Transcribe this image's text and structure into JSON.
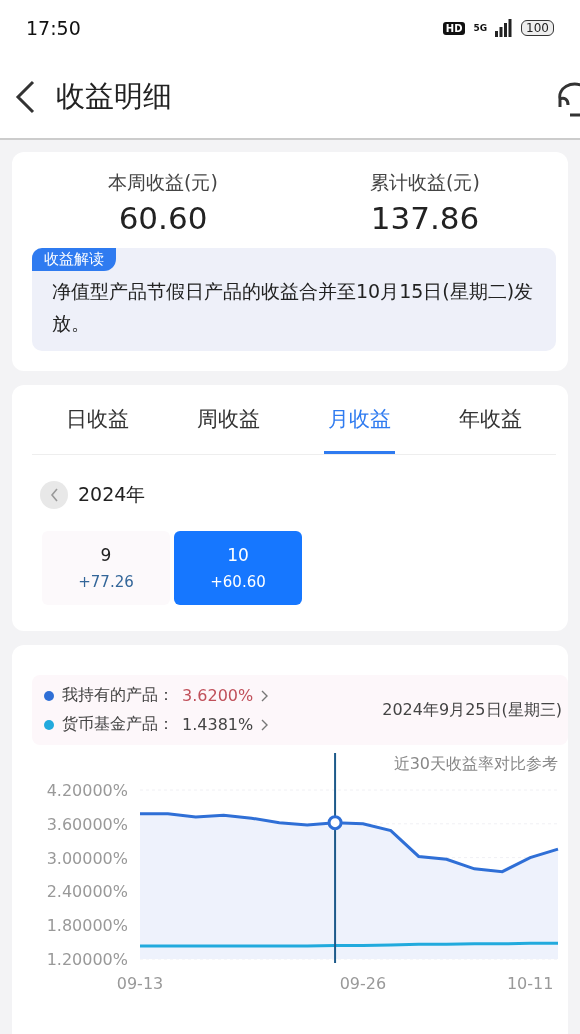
{
  "status_bar": {
    "time": "17:50",
    "hd": "HD",
    "network": "5G",
    "battery": "100"
  },
  "header": {
    "title": "收益明细"
  },
  "summary": {
    "stats": [
      {
        "label": "本周收益(元)",
        "value": "60.60"
      },
      {
        "label": "累计收益(元)",
        "value": "137.86"
      }
    ],
    "note": {
      "tag": "收益解读",
      "text": "净值型产品节假日产品的收益合并至10月15日(星期二)发放。"
    }
  },
  "tabs": [
    {
      "label": "日收益",
      "selected": false
    },
    {
      "label": "周收益",
      "selected": false
    },
    {
      "label": "月收益",
      "selected": true
    },
    {
      "label": "年收益",
      "selected": false
    }
  ],
  "year": "2024年",
  "months": [
    {
      "month": "9",
      "amount": "+77.26",
      "selected": false
    },
    {
      "month": "10",
      "amount": "+60.60",
      "selected": true
    }
  ],
  "comparison": {
    "legend": [
      {
        "label": "我持有的产品：",
        "value": "3.6200%",
        "color": "#2f6fd6"
      },
      {
        "label": "货币基金产品：",
        "value": "1.4381%",
        "color": "#22aadd"
      }
    ],
    "date": "2024年9月25日(星期三)",
    "caption": "近30天收益率对比参考",
    "chart_data": {
      "type": "line",
      "categories": [
        "09-13",
        null,
        null,
        null,
        null,
        null,
        null,
        null,
        "09-26",
        null,
        null,
        null,
        null,
        null,
        "10-11",
        null
      ],
      "series": [
        {
          "color": "#2f6fd6",
          "values": [
            3.78,
            3.78,
            3.72,
            3.75,
            3.7,
            3.62,
            3.58,
            3.62,
            3.6,
            3.48,
            3.02,
            2.97,
            2.8,
            2.75,
            3.0,
            3.15
          ]
        },
        {
          "color": "#22aadd",
          "values": [
            1.43,
            1.43,
            1.43,
            1.43,
            1.43,
            1.43,
            1.43,
            1.44,
            1.44,
            1.45,
            1.46,
            1.46,
            1.47,
            1.47,
            1.48,
            1.48
          ]
        }
      ],
      "ylim": [
        1.2,
        4.2
      ],
      "yticks": [
        {
          "value": 4.2,
          "label": "4.20000%"
        },
        {
          "value": 3.6,
          "label": "3.60000%"
        },
        {
          "value": 3.0,
          "label": "3.00000%"
        },
        {
          "value": 2.4,
          "label": "2.40000%"
        },
        {
          "value": 1.8,
          "label": "1.80000%"
        },
        {
          "value": 1.2,
          "label": "1.20000%"
        }
      ]
    }
  }
}
